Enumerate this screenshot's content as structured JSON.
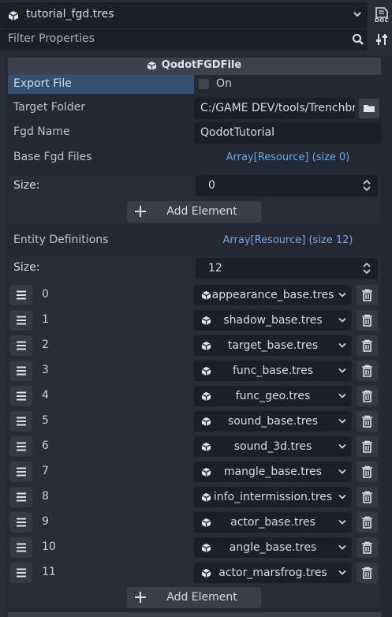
{
  "top": {
    "title": "tutorial_fgd.tres",
    "doc_label": "DOC"
  },
  "filter": {
    "placeholder": "Filter Properties"
  },
  "header": {
    "title": "QodotFGDFile"
  },
  "props": {
    "export_file": {
      "label": "Export File",
      "value": "On",
      "checked": false
    },
    "target_folder": {
      "label": "Target Folder",
      "value": "C:/GAME DEV/tools/Trenchbr"
    },
    "fgd_name": {
      "label": "Fgd Name",
      "value": "QodotTutorial"
    },
    "base_fgd_files": {
      "label": "Base Fgd Files",
      "value": "Array[Resource] (size 0)",
      "size_label": "Size:",
      "size": "0",
      "add_label": "Add Element"
    },
    "entity_definitions": {
      "label": "Entity Definitions",
      "value": "Array[Resource] (size 12)",
      "size_label": "Size:",
      "size": "12",
      "add_label": "Add Element",
      "items": [
        {
          "index": "0",
          "name": "appearance_base.tres"
        },
        {
          "index": "1",
          "name": "shadow_base.tres"
        },
        {
          "index": "2",
          "name": "target_base.tres"
        },
        {
          "index": "3",
          "name": "func_base.tres"
        },
        {
          "index": "4",
          "name": "func_geo.tres"
        },
        {
          "index": "5",
          "name": "sound_base.tres"
        },
        {
          "index": "6",
          "name": "sound_3d.tres"
        },
        {
          "index": "7",
          "name": "mangle_base.tres"
        },
        {
          "index": "8",
          "name": "info_intermission.tres"
        },
        {
          "index": "9",
          "name": "actor_base.tres"
        },
        {
          "index": "10",
          "name": "angle_base.tres"
        },
        {
          "index": "11",
          "name": "actor_marsfrog.tres"
        }
      ]
    }
  },
  "colors": {
    "accent_link": "#6ba9e5",
    "selected_row": "#34506f",
    "panel_bg": "#232833"
  }
}
